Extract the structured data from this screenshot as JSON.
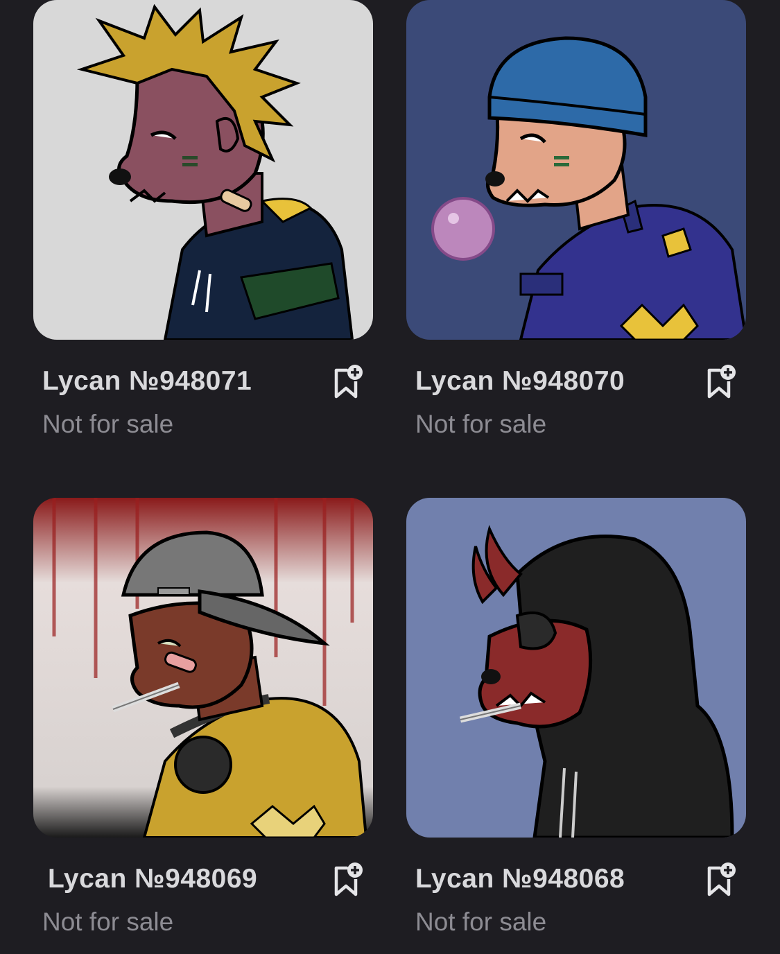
{
  "colors": {
    "background": "#1e1d22",
    "title_text": "#d9d9dc",
    "status_text": "#8d8c93"
  },
  "items": [
    {
      "title": "Lycan №948071",
      "status": "Not for sale",
      "background": "#d8d8d8",
      "skin": "#8a5060",
      "bookmark_icon": "bookmark-add-icon"
    },
    {
      "title": "Lycan №948070",
      "status": "Not for sale",
      "background": "#3b4a78",
      "skin": "#e2a488",
      "bookmark_icon": "bookmark-add-icon"
    },
    {
      "title": "Lycan №948069",
      "status": "Not for sale",
      "background": "#e6e1df",
      "skin": "#7a3a2a",
      "bookmark_icon": "bookmark-add-icon"
    },
    {
      "title": "Lycan №948068",
      "status": "Not for sale",
      "background": "#7180ad",
      "skin": "#8a2a2a",
      "bookmark_icon": "bookmark-add-icon"
    }
  ]
}
